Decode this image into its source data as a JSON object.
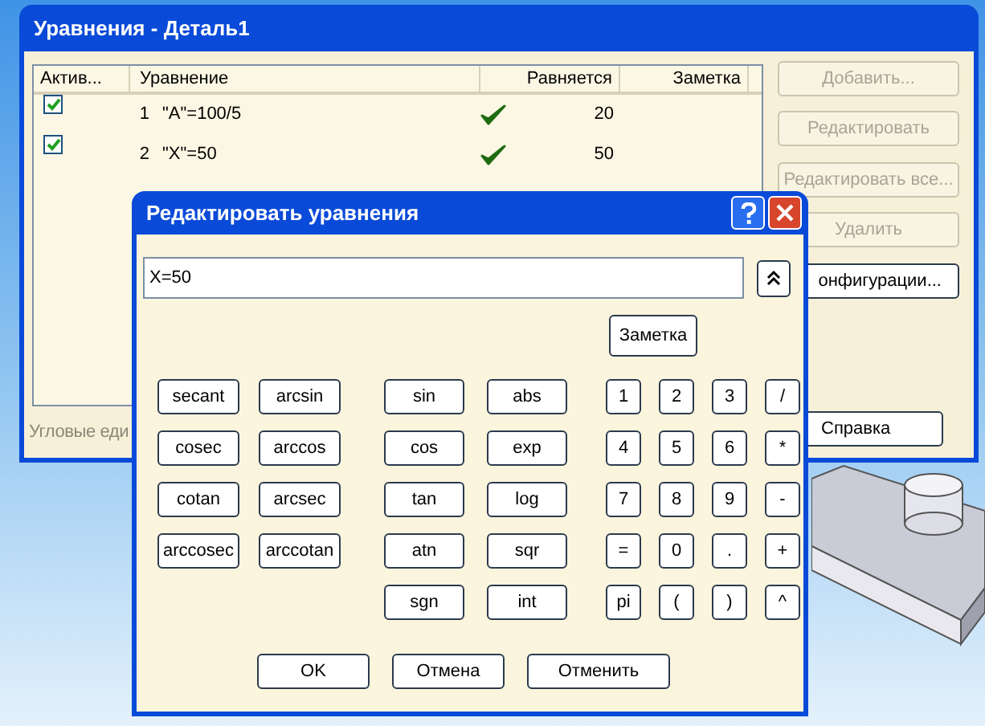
{
  "main_window": {
    "title": "Уравнения - Деталь1",
    "columns": [
      "Актив...",
      "Уравнение",
      "Равняется",
      "Заметка"
    ],
    "rows": [
      {
        "active": true,
        "index": "1",
        "equation": "\"A\"=100/5",
        "value": "20"
      },
      {
        "active": true,
        "index": "2",
        "equation": "\"X\"=50",
        "value": "50"
      }
    ],
    "buttons": [
      {
        "label": "Добавить...",
        "disabled": true
      },
      {
        "label": "Редактировать",
        "disabled": true
      },
      {
        "label": "Редактировать все...",
        "disabled": true
      },
      {
        "label": "Удалить",
        "disabled": true
      },
      {
        "label": "онфигурации...",
        "disabled": false
      }
    ],
    "help_button": "Справка",
    "footer": "Угловые еди"
  },
  "dialog": {
    "title": "Редактировать уравнения",
    "expression": "X=50",
    "note_button": "Заметка",
    "trig_buttons": [
      "secant",
      "arcsin",
      "cosec",
      "arccos",
      "cotan",
      "arcsec",
      "arccosec",
      "arccotan"
    ],
    "function_buttons": [
      "sin",
      "abs",
      "cos",
      "exp",
      "tan",
      "log",
      "atn",
      "sqr",
      "sgn",
      "int"
    ],
    "keypad": [
      "1",
      "2",
      "3",
      "/",
      "4",
      "5",
      "6",
      "*",
      "7",
      "8",
      "9",
      "-",
      "=",
      "0",
      ".",
      "+",
      "pi",
      "(",
      ")",
      "^"
    ],
    "actions": [
      "OK",
      "Отмена",
      "Отменить"
    ]
  }
}
